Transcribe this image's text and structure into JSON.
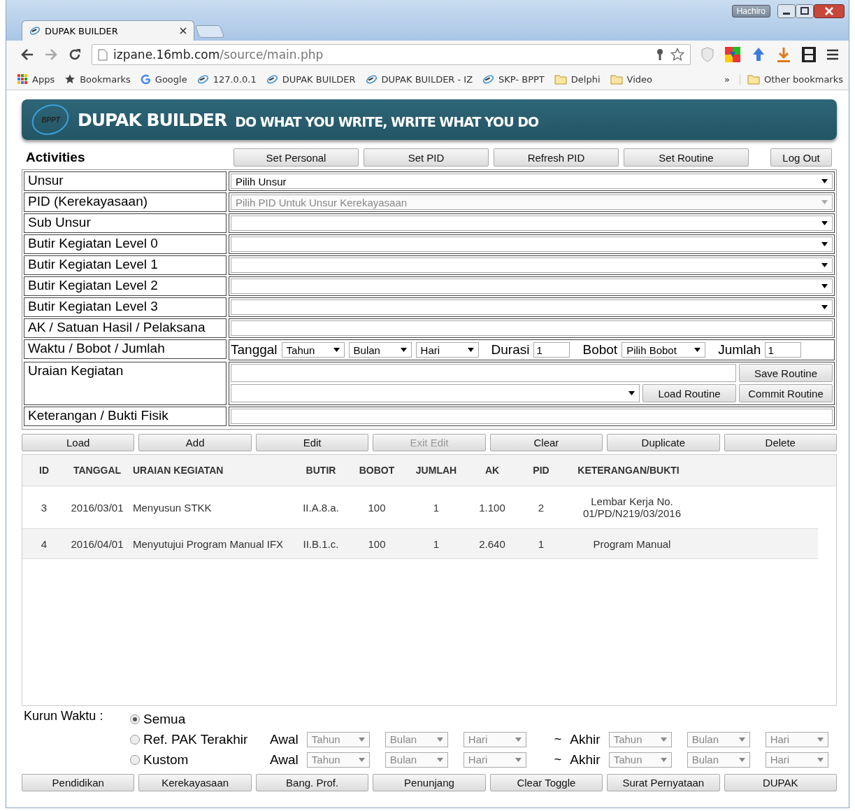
{
  "window": {
    "user": "Hachiro"
  },
  "browser": {
    "tab": {
      "title": "DUPAK BUILDER"
    },
    "address": {
      "host": "izpane.16mb.com",
      "path": "/source/main.php"
    },
    "bookmarks": [
      {
        "kind": "apps",
        "label": "Apps"
      },
      {
        "kind": "star",
        "label": "Bookmarks"
      },
      {
        "kind": "google",
        "label": "Google"
      },
      {
        "kind": "logo",
        "label": "127.0.0.1"
      },
      {
        "kind": "logo",
        "label": "DUPAK BUILDER"
      },
      {
        "kind": "logo",
        "label": "DUPAK BUILDER - IZ"
      },
      {
        "kind": "logo",
        "label": "SKP- BPPT"
      },
      {
        "kind": "folder",
        "label": "Delphi"
      },
      {
        "kind": "folder",
        "label": "Video"
      }
    ],
    "overflow": "»",
    "other_bookmarks": "Other bookmarks"
  },
  "header": {
    "logo": "BPPT",
    "title": "DUPAK BUILDER",
    "tagline": "DO WHAT YOU WRITE, WRITE WHAT YOU DO"
  },
  "activities": {
    "title": "Activities",
    "buttons": [
      "Set Personal",
      "Set PID",
      "Refresh PID",
      "Set Routine"
    ],
    "logout": "Log Out"
  },
  "form": [
    {
      "kind": "select",
      "label": "Unsur",
      "value": "Pilih Unsur",
      "disabled": false
    },
    {
      "kind": "select",
      "label": "PID (Kerekayasaan)",
      "value": "Pilih PID Untuk Unsur Kerekayasaan",
      "disabled": true
    },
    {
      "kind": "select",
      "label": "Sub Unsur",
      "disabled": false
    },
    {
      "kind": "select",
      "label": "Butir Kegiatan Level 0",
      "disabled": false
    },
    {
      "kind": "select",
      "label": "Butir Kegiatan Level 1",
      "disabled": false
    },
    {
      "kind": "select",
      "label": "Butir Kegiatan Level 2",
      "disabled": false
    },
    {
      "kind": "select",
      "label": "Butir Kegiatan Level 3",
      "disabled": false
    },
    {
      "kind": "input",
      "label": "AK / Satuan Hasil / Pelaksana"
    },
    {
      "kind": "waktu",
      "label": "Waktu / Bobot / Jumlah",
      "tanggal": "Tanggal",
      "date_selects": [
        "Tahun",
        "Bulan",
        "Hari"
      ],
      "durasi_label": "Durasi",
      "durasi": "1",
      "bobot_label": "Bobot",
      "bobot": "Pilih Bobot",
      "jumlah_label": "Jumlah",
      "jumlah": "1"
    },
    {
      "kind": "uraian",
      "label": "Uraian Kegiatan",
      "save": "Save Routine",
      "load": "Load Routine",
      "commit": "Commit Routine"
    },
    {
      "kind": "input",
      "label": "Keterangan / Bukti Fisik"
    }
  ],
  "actions": [
    {
      "label": "Load",
      "disabled": false
    },
    {
      "label": "Add",
      "disabled": false
    },
    {
      "label": "Edit",
      "disabled": false
    },
    {
      "label": "Exit Edit",
      "disabled": true
    },
    {
      "label": "Clear",
      "disabled": false
    },
    {
      "label": "Duplicate",
      "disabled": false
    },
    {
      "label": "Delete",
      "disabled": false
    }
  ],
  "table": {
    "columns": [
      "ID",
      "TANGGAL",
      "URAIAN KEGIATAN",
      "BUTIR",
      "BOBOT",
      "JUMLAH",
      "AK",
      "PID",
      "KETERANGAN/BUKTI"
    ],
    "rows": [
      {
        "cells": [
          "3",
          "2016/03/01",
          "Menyusun STKK",
          "II.A.8.a.",
          "100",
          "1",
          "1.100",
          "2",
          "Lembar Kerja No. 01/PD/N219/03/2016"
        ]
      },
      {
        "cells": [
          "4",
          "2016/04/01",
          "Menyutujui Program Manual IFX",
          "II.B.1.c.",
          "100",
          "1",
          "2.640",
          "1",
          "Program Manual"
        ]
      }
    ]
  },
  "kurun_waktu": {
    "label": "Kurun Waktu :",
    "options": [
      {
        "label": "Semua",
        "selected": true
      },
      {
        "label": "Ref. PAK Terakhir",
        "selected": false,
        "range": {
          "awal": "Awal",
          "tilde": "~",
          "akhir": "Akhir",
          "start": [
            "Tahun",
            "Bulan",
            "Hari"
          ],
          "end": [
            "Tahun",
            "Bulan",
            "Hari"
          ],
          "disabled": true
        }
      },
      {
        "label": "Kustom",
        "selected": false,
        "range": {
          "awal": "Awal",
          "tilde": "~",
          "akhir": "Akhir",
          "start": [
            "Tahun",
            "Bulan",
            "Hari"
          ],
          "end": [
            "Tahun",
            "Bulan",
            "Hari"
          ],
          "disabled": true
        }
      }
    ]
  },
  "bottom_buttons": [
    "Pendidikan",
    "Kerekayasaan",
    "Bang. Prof.",
    "Penunjang",
    "Clear Toggle",
    "Surat Pernyataan",
    "DUPAK"
  ]
}
